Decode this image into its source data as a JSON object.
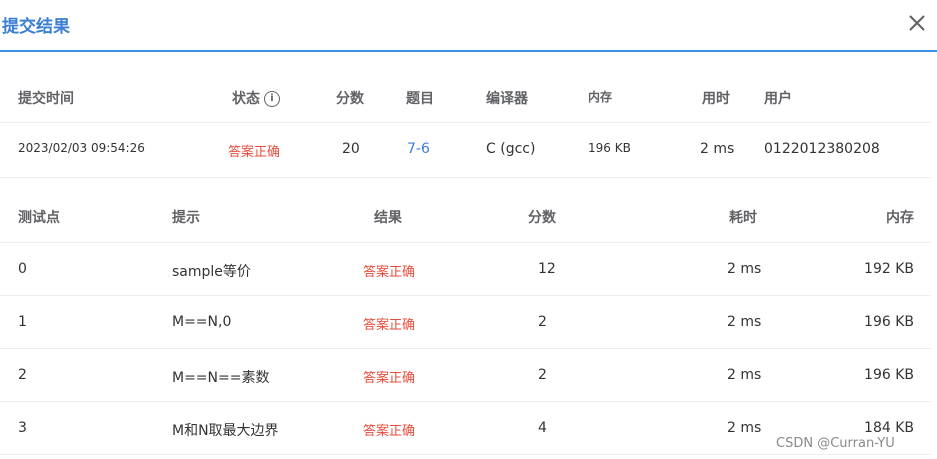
{
  "dialog": {
    "title": "提交结果"
  },
  "summary": {
    "headers": [
      "提交时间",
      "状态",
      "分数",
      "题目",
      "编译器",
      "内存",
      "用时",
      "用户"
    ],
    "values": {
      "time": "2023/02/03 09:54:26",
      "status": "答案正确",
      "score": "20",
      "problem": "7-6",
      "compiler": "C (gcc)",
      "memory": "196 KB",
      "duration": "2 ms",
      "user": "0122012380208"
    }
  },
  "table": {
    "headers": [
      "测试点",
      "提示",
      "结果",
      "分数",
      "耗时",
      "内存"
    ],
    "rows": [
      {
        "id": "0",
        "hint": "sample等价",
        "result": "答案正确",
        "score": "12",
        "time": "2 ms",
        "memory": "192 KB"
      },
      {
        "id": "1",
        "hint": "M==N,0",
        "result": "答案正确",
        "score": "2",
        "time": "2 ms",
        "memory": "196 KB"
      },
      {
        "id": "2",
        "hint": "M==N==素数",
        "result": "答案正确",
        "score": "2",
        "time": "2 ms",
        "memory": "196 KB"
      },
      {
        "id": "3",
        "hint": "M和N取最大边界",
        "result": "答案正确",
        "score": "4",
        "time": "2 ms",
        "memory": "184 KB"
      }
    ]
  },
  "watermark": "CSDN @Curran-YU",
  "colors": {
    "accent": "#3b8fe6",
    "success_text": "#e74c3c",
    "link": "#3b7fd4"
  },
  "icons": [
    "close-icon",
    "info-icon"
  ]
}
